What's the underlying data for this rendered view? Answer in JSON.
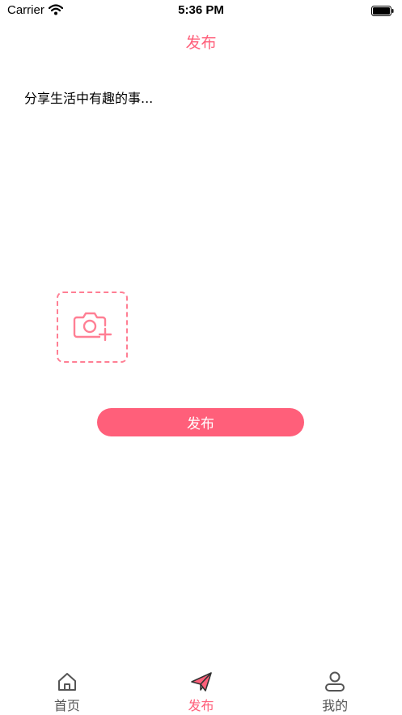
{
  "status_bar": {
    "carrier": "Carrier",
    "time": "5:36 PM"
  },
  "nav": {
    "title": "发布"
  },
  "composer": {
    "placeholder": "分享生活中有趣的事...",
    "value": ""
  },
  "publish_button": {
    "label": "发布"
  },
  "tabs": [
    {
      "label": "首页",
      "icon": "home-icon",
      "active": false
    },
    {
      "label": "发布",
      "icon": "paper-plane-icon",
      "active": true
    },
    {
      "label": "我的",
      "icon": "user-icon",
      "active": false
    }
  ],
  "colors": {
    "accent": "#ff5f7a",
    "tab_inactive": "#555555"
  }
}
